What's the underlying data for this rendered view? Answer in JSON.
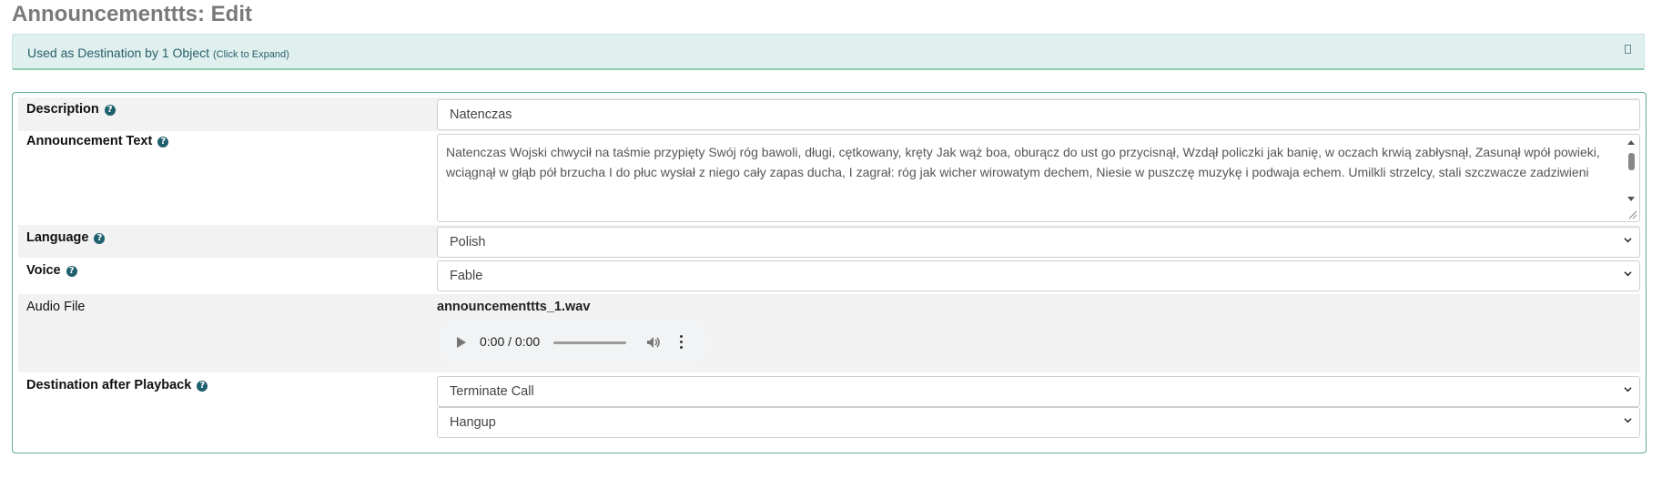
{
  "page": {
    "title": "Announcementtts: Edit"
  },
  "destination_panel": {
    "text": "Used as Destination by 1 Object",
    "hint": "(Click to Expand)"
  },
  "form": {
    "description": {
      "label": "Description",
      "help": "?",
      "value": "Natenczas"
    },
    "announcement_text": {
      "label": "Announcement Text",
      "help": "?",
      "value": "Natenczas Wojski chwycił na taśmie przypięty Swój róg bawoli, długi, cętkowany, kręty Jak wąż boa, oburącz do ust go przycisnął, Wzdął policzki jak banię, w oczach krwią zabłysnął, Zasunął wpół powieki, wciągnął w głąb pół brzucha I do płuc wysłał z niego cały zapas ducha, I zagrał: róg jak wicher wirowatym dechem, Niesie w puszczę muzykę i podwaja echem. Umilkli strzelcy, stali szczwacze zadziwieni"
    },
    "language": {
      "label": "Language",
      "help": "?",
      "value": "Polish"
    },
    "voice": {
      "label": "Voice",
      "help": "?",
      "value": "Fable"
    },
    "audio": {
      "label": "Audio File",
      "file_name": "announcementtts_1.wav",
      "time": "0:00 / 0:00",
      "progress": 0
    },
    "destination": {
      "label": "Destination after Playback",
      "help": "?",
      "category": "Terminate Call",
      "target": "Hangup"
    }
  },
  "colors": {
    "panel_bg": "#dff0ee",
    "panel_text": "#2a5f6a",
    "form_border": "#5fae8a",
    "help_icon": "#1e5f6e",
    "row_shade": "#f2f2f2"
  },
  "icons": [
    "help-icon",
    "expand-toggle-icon",
    "chevron-down-icon",
    "play-icon",
    "volume-icon",
    "more-options-icon",
    "resize-handle-icon"
  ]
}
